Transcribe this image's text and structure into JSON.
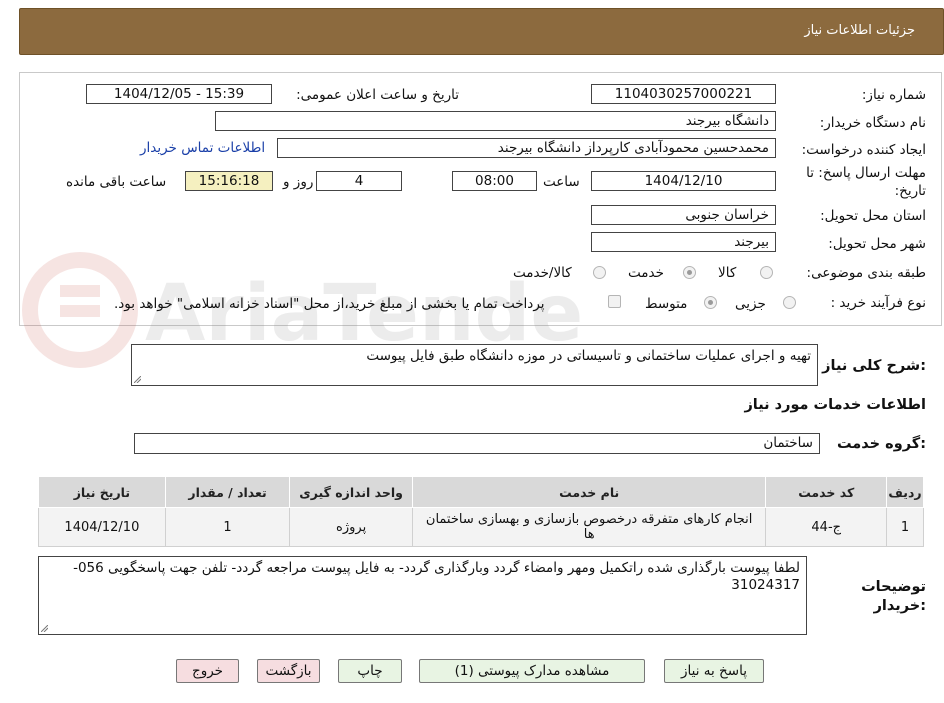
{
  "header": {
    "title": "جزئیات اطلاعات نیاز"
  },
  "fields": {
    "need_number_label": "شماره نیاز:",
    "need_number": "1104030257000221",
    "announce_label": "تاریخ و ساعت اعلان عمومی:",
    "announce_value": "1404/12/05 - 15:39",
    "buyer_org_label": "نام دستگاه خریدار:",
    "buyer_org": "دانشگاه بیرجند",
    "requester_label": "ایجاد کننده درخواست:",
    "requester": "محمدحسین محمودآبادی کارپرداز دانشگاه بیرجند",
    "contact_link": "اطلاعات تماس خریدار",
    "deadline_label": "مهلت ارسال پاسخ: تا تاریخ:",
    "deadline_date": "1404/12/10",
    "time_label": "ساعت",
    "deadline_time": "08:00",
    "days_value": "4",
    "days_label": "روز و",
    "remaining_time": "15:16:18",
    "remaining_label": "ساعت باقی مانده",
    "province_label": "استان محل تحویل:",
    "province": "خراسان جنوبی",
    "city_label": "شهر محل تحویل:",
    "city": "بیرجند",
    "category_label": "طبقه بندی موضوعی:",
    "category_options": [
      "کالا",
      "خدمت",
      "کالا/خدمت"
    ],
    "category_selected": "خدمت",
    "process_label": "نوع فرآیند خرید :",
    "process_options": [
      "جزیی",
      "متوسط"
    ],
    "process_selected": "متوسط",
    "payment_note": "پرداخت تمام یا بخشی از مبلغ خرید،از محل \"اسناد خزانه اسلامی\" خواهد بود."
  },
  "description": {
    "label": "شرح کلی نیاز:",
    "value": "تهیه و اجرای عملیات ساختمانی و تاسیساتی در موزه دانشگاه طبق فایل پیوست"
  },
  "services": {
    "section_title": "اطلاعات خدمات مورد نیاز",
    "group_label": "گروه خدمت:",
    "group_value": "ساختمان",
    "columns": [
      "ردیف",
      "کد خدمت",
      "نام خدمت",
      "واحد اندازه گیری",
      "تعداد / مقدار",
      "تاریخ نیاز"
    ],
    "rows": [
      {
        "index": "1",
        "code": "ج-44",
        "name": "انجام کارهای متفرقه درخصوص بازسازی و بهسازی ساختمان ها",
        "unit": "پروژه",
        "qty": "1",
        "date": "1404/12/10"
      }
    ]
  },
  "buyer_notes": {
    "label": "توضیحات خریدار:",
    "value": "لطفا پیوست بارگذاری شده راتکمیل ومهر وامضاء گردد وبارگذاری گردد- به فایل پیوست مراجعه گردد- تلفن جهت پاسخگویی 056- 31024317"
  },
  "buttons": {
    "reply": "پاسخ به نیاز",
    "attachments": "مشاهده مدارک پیوستی (1)",
    "print": "چاپ",
    "back": "بازگشت",
    "exit": "خروج"
  },
  "colors": {
    "header_bg": "#8c6a3e",
    "highlight": "#f5f0c0",
    "link": "#1a3fa8"
  },
  "watermark": {
    "text": "AriaTender.neT"
  }
}
